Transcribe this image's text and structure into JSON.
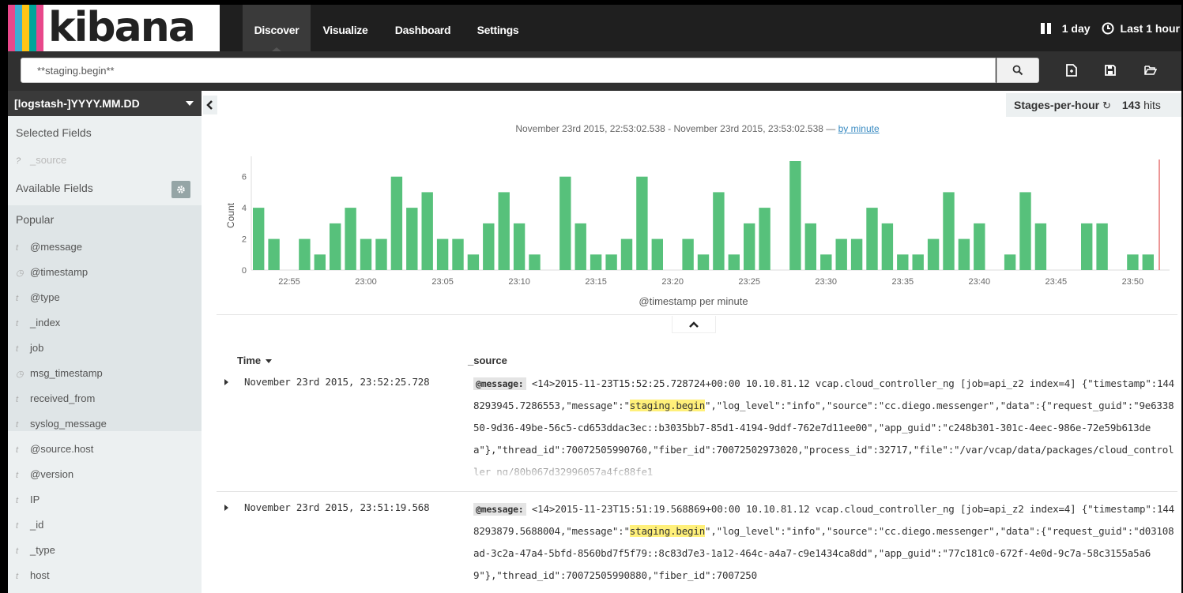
{
  "app": {
    "logo_text": "kibana",
    "stripe_colors": [
      "#e8488b",
      "#3caed2",
      "#fec514",
      "#00a69b",
      "#e8488b"
    ]
  },
  "nav": {
    "tabs": [
      {
        "label": "Discover"
      },
      {
        "label": "Visualize"
      },
      {
        "label": "Dashboard"
      },
      {
        "label": "Settings"
      }
    ],
    "active": "Discover",
    "interval_label": "1 day",
    "timepicker_label": "Last 1 hour"
  },
  "search": {
    "query": "**staging.begin**"
  },
  "sidebar": {
    "index_pattern": "[logstash-]YYYY.MM.DD",
    "selected_fields_title": "Selected Fields",
    "selected_fields": [
      {
        "type": "?",
        "name": "_source"
      }
    ],
    "available_fields_title": "Available Fields",
    "popular_title": "Popular",
    "popular_fields": [
      {
        "type": "t",
        "name": "@message"
      },
      {
        "type": "clock",
        "name": "@timestamp"
      },
      {
        "type": "t",
        "name": "@type"
      },
      {
        "type": "t",
        "name": "_index"
      },
      {
        "type": "t",
        "name": "job"
      },
      {
        "type": "clock",
        "name": "msg_timestamp"
      },
      {
        "type": "t",
        "name": "received_from"
      },
      {
        "type": "t",
        "name": "syslog_message"
      }
    ],
    "other_fields": [
      {
        "type": "t",
        "name": "@source.host"
      },
      {
        "type": "t",
        "name": "@version"
      },
      {
        "type": "t",
        "name": "IP"
      },
      {
        "type": "t",
        "name": "_id"
      },
      {
        "type": "t",
        "name": "_type"
      },
      {
        "type": "t",
        "name": "host"
      }
    ]
  },
  "hits": {
    "saved_search": "Stages-per-hour",
    "count": "143",
    "label": "hits"
  },
  "histogram": {
    "time_range": "November 23rd 2015, 22:53:02.538 - November 23rd 2015, 23:53:02.538 —",
    "interval_link": "by minute"
  },
  "chart_data": {
    "type": "bar",
    "xlabel": "@timestamp per minute",
    "ylabel": "Count",
    "ylim": [
      0,
      7
    ],
    "yticks": [
      0,
      2,
      4,
      6
    ],
    "xtick_labels": [
      "22:55",
      "23:00",
      "23:05",
      "23:10",
      "23:15",
      "23:20",
      "23:25",
      "23:30",
      "23:35",
      "23:40",
      "23:45",
      "23:50"
    ],
    "color": "#57c17b",
    "values": [
      4,
      2,
      0,
      2,
      1,
      3,
      4,
      2,
      2,
      6,
      4,
      5,
      2,
      2,
      1,
      3,
      5,
      3,
      1,
      0,
      6,
      3,
      1,
      1,
      2,
      6,
      2,
      0,
      2,
      1,
      5,
      1,
      3,
      4,
      0,
      7,
      3,
      1,
      2,
      2,
      4,
      3,
      1,
      1,
      2,
      5,
      2,
      3,
      0,
      1,
      5,
      3,
      0,
      0,
      3,
      3,
      0,
      1,
      1
    ]
  },
  "table": {
    "time_header": "Time",
    "source_header": "_source",
    "rows": [
      {
        "time": "November 23rd 2015, 23:52:25.728",
        "label": "@message:",
        "pre": " <14>2015-11-23T15:52:25.728724+00:00 10.10.81.12 vcap.cloud_controller_ng [job=api_z2 index=4] {\"timestamp\":1448293945.7286553,\"message\":\"",
        "hl": "staging.begin",
        "post": "\",\"log_level\":\"info\",\"source\":\"cc.diego.messenger\",\"data\":{\"request_guid\":\"9e633850-9d36-49be-56c5-cd653ddac3ec::b3035bb7-85d1-4194-9ddf-762e7d11ee00\",\"app_guid\":\"c248b301-301c-4eec-986e-72e59b613dea\"},\"thread_id\":70072505990760,\"fiber_id\":70072502973020,\"process_id\":32717,\"file\":\"/var/vcap/data/packages/cloud_controller_ng/80b067d32996057a4fc88fe1"
      },
      {
        "time": "November 23rd 2015, 23:51:19.568",
        "label": "@message:",
        "pre": " <14>2015-11-23T15:51:19.568869+00:00 10.10.81.12 vcap.cloud_controller_ng [job=api_z2 index=4] {\"timestamp\":1448293879.5688004,\"message\":\"",
        "hl": "staging.begin",
        "post": "\",\"log_level\":\"info\",\"source\":\"cc.diego.messenger\",\"data\":{\"request_guid\":\"d03108ad-3c2a-47a4-5bfd-8560bd7f5f79::8c83d7e3-1a12-464c-a4a7-c9e1434ca8dd\",\"app_guid\":\"77c181c0-672f-4e0d-9c7a-58c3155a5a69\"},\"thread_id\":70072505990880,\"fiber_id\":7007250"
      }
    ]
  }
}
